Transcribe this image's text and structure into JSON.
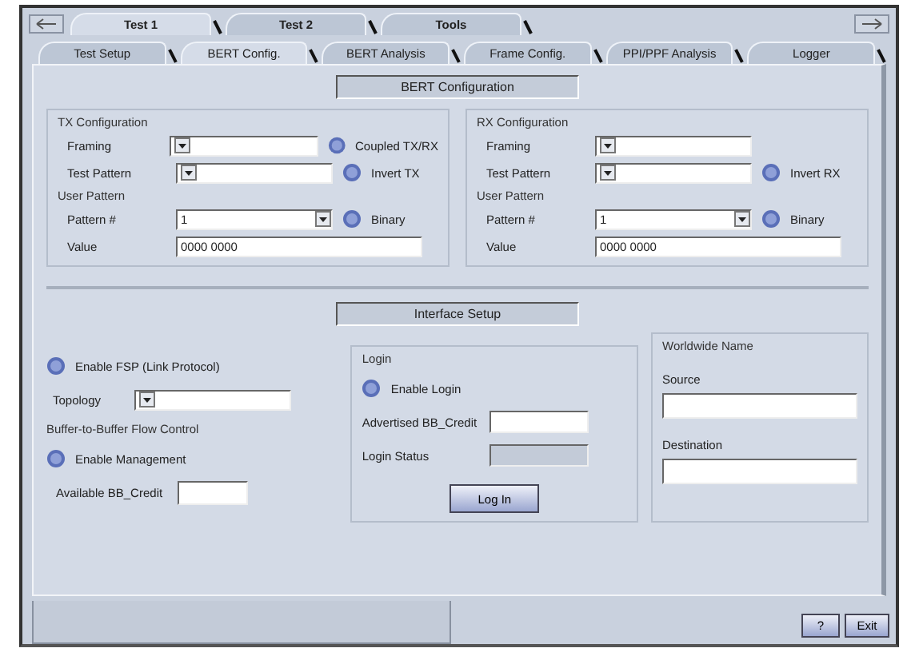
{
  "top_tabs": [
    {
      "label": "Test 1",
      "selected": true
    },
    {
      "label": "Test 2",
      "selected": false
    },
    {
      "label": "Tools",
      "selected": false
    }
  ],
  "sub_tabs": [
    {
      "label": "Test Setup",
      "selected": false
    },
    {
      "label": "BERT Config.",
      "selected": true
    },
    {
      "label": "BERT Analysis",
      "selected": false
    },
    {
      "label": "Frame Config.",
      "selected": false
    },
    {
      "label": "PPI/PPF Analysis",
      "selected": false
    },
    {
      "label": "Logger",
      "selected": false
    }
  ],
  "bert": {
    "title": "BERT Configuration",
    "groups": [
      {
        "title": "TX Configuration",
        "rows": [
          {
            "label": "Framing",
            "toggle": {
              "label": "Coupled TX/RX",
              "checked": false
            }
          },
          {
            "label": "Test Pattern",
            "toggle": {
              "label": "Invert TX",
              "checked": false
            }
          }
        ],
        "user_pattern": {
          "title": "User Pattern",
          "pattern_label": "Pattern #",
          "pattern_value": "1",
          "toggle": {
            "label": "Binary",
            "checked": false
          },
          "value_label": "Value",
          "value": "0000 0000"
        }
      },
      {
        "title": "RX Configuration",
        "rows": [
          {
            "label": "Framing"
          },
          {
            "label": "Test Pattern",
            "toggle": {
              "label": "Invert RX",
              "checked": false
            }
          }
        ],
        "user_pattern": {
          "title": "User Pattern",
          "pattern_label": "Pattern #",
          "pattern_value": "1",
          "toggle": {
            "label": "Binary",
            "checked": false
          },
          "value_label": "Value",
          "value": "0000 0000"
        }
      }
    ]
  },
  "interface": {
    "title": "Interface Setup",
    "fsp_toggle": {
      "label": "Enable FSP (Link Protocol)",
      "checked": false
    },
    "topology_label": "Topology",
    "flow": {
      "title": "Buffer-to-Buffer Flow Control",
      "toggle": {
        "label": "Enable Management",
        "checked": false
      },
      "credit_label": "Available BB_Credit"
    },
    "login": {
      "title": "Login",
      "toggle": {
        "label": "Enable Login",
        "checked": false
      },
      "fields": [
        {
          "label": "Advertised BB_Credit",
          "disabled": false
        },
        {
          "label": "Login Status",
          "disabled": true
        }
      ],
      "button": "Log In"
    },
    "wwn": {
      "title": "Worldwide Name",
      "fields": [
        "Source",
        "Destination"
      ]
    }
  },
  "footer_buttons": [
    "?",
    "Exit"
  ]
}
